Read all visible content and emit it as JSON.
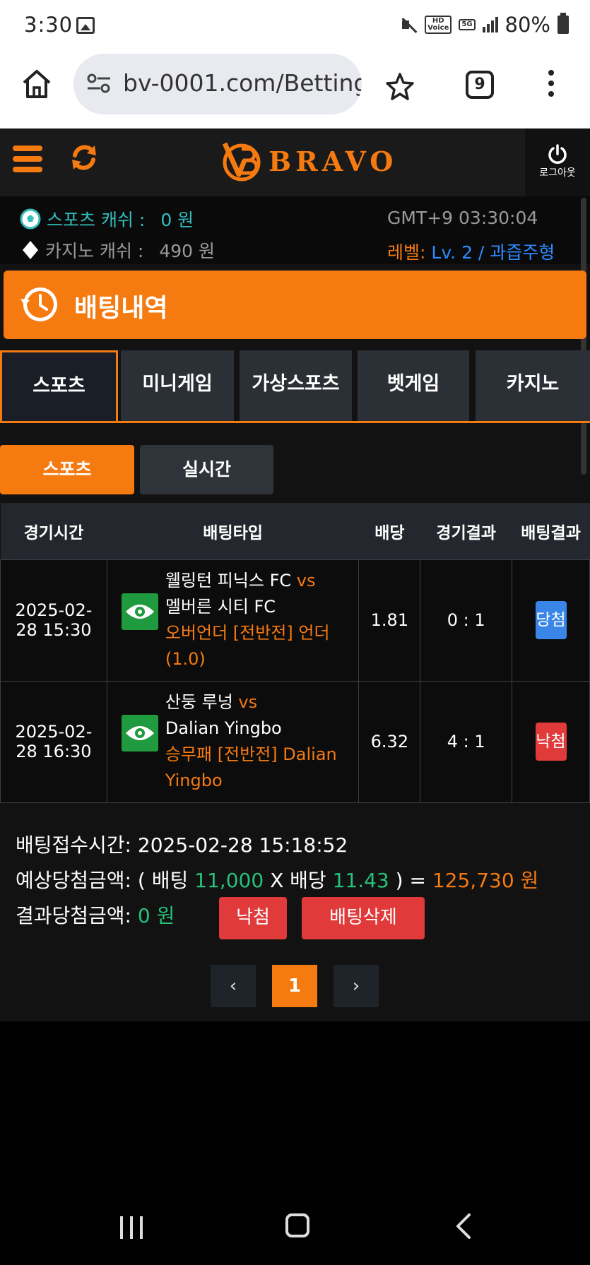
{
  "status": {
    "time": "3:30",
    "tag_hd": "HD\nVoice",
    "tag_5g": "5G",
    "battery": "80%"
  },
  "browser": {
    "url": "bv-0001.com/Betting",
    "tab_count": "9"
  },
  "header": {
    "logo_text": "BRAVO",
    "logout_label": "로그아웃"
  },
  "info": {
    "sports_cash_label": "스포츠 캐쉬 :",
    "sports_cash_value": "0 원",
    "casino_cash_label": "카지노 캐쉬 :",
    "casino_cash_value": "490 원",
    "gmt": "GMT+9 03:30:04",
    "level_label": "레벨:",
    "level_value": "Lv. 2 / 과즙주형"
  },
  "page_title": "배팅내역",
  "main_tabs": [
    {
      "label": "스포츠",
      "active": true
    },
    {
      "label": "미니게임",
      "active": false
    },
    {
      "label": "가상스포츠",
      "active": false
    },
    {
      "label": "벳게임",
      "active": false
    },
    {
      "label": "카지노",
      "active": false
    }
  ],
  "sub_tabs": [
    {
      "label": "스포츠",
      "active": true
    },
    {
      "label": "실시간",
      "active": false
    }
  ],
  "table": {
    "headers": [
      "경기시간",
      "배팅타입",
      "배당",
      "경기결과",
      "배팅결과"
    ],
    "rows": [
      {
        "time_date": "2025-02-",
        "time_rest": "28 15:30",
        "home": "웰링턴 피닉스 FC",
        "vs": "vs",
        "away": "멜버른 시티 FC",
        "market": "오버언더 [전반전] 언더 (1.0)",
        "odds": "1.81",
        "score": "0 : 1",
        "result": "당첨",
        "result_type": "win"
      },
      {
        "time_date": "2025-02-",
        "time_rest": "28 16:30",
        "home": "산둥 루넝",
        "vs": "vs",
        "away": "Dalian Yingbo",
        "market": "승무패 [전반전] Dalian Yingbo",
        "odds": "6.32",
        "score": "4 : 1",
        "result": "낙첨",
        "result_type": "lose"
      }
    ]
  },
  "summary": {
    "accept_time_label": "배팅접수시간:",
    "accept_time_value": "2025-02-28 15:18:52",
    "expected_label": "예상당첨금액:",
    "expected_open": "( 배팅",
    "bet_amount": "11,000",
    "x_text": "X 배당",
    "total_odds": "11.43",
    "close_eq": ") =",
    "expected_amount": "125,730 원",
    "result_label": "결과당첨금액:",
    "result_amount": "0 원",
    "status_button": "낙첨",
    "delete_button": "배팅삭제"
  },
  "pagination": {
    "prev": "‹",
    "current": "1",
    "next": "›"
  },
  "colors": {
    "accent": "#f57a10",
    "win": "#3a86e8",
    "lose": "#e03a3a",
    "green": "#26c17a",
    "teal": "#33bdbd",
    "blue": "#2e8bff"
  },
  "icons": [
    "home-icon",
    "tune-icon",
    "star-icon",
    "menu-icon",
    "hamburger-icon",
    "refresh-icon",
    "power-icon",
    "soccer-ball-icon",
    "diamond-icon",
    "history-clock-icon",
    "eye-icon"
  ]
}
